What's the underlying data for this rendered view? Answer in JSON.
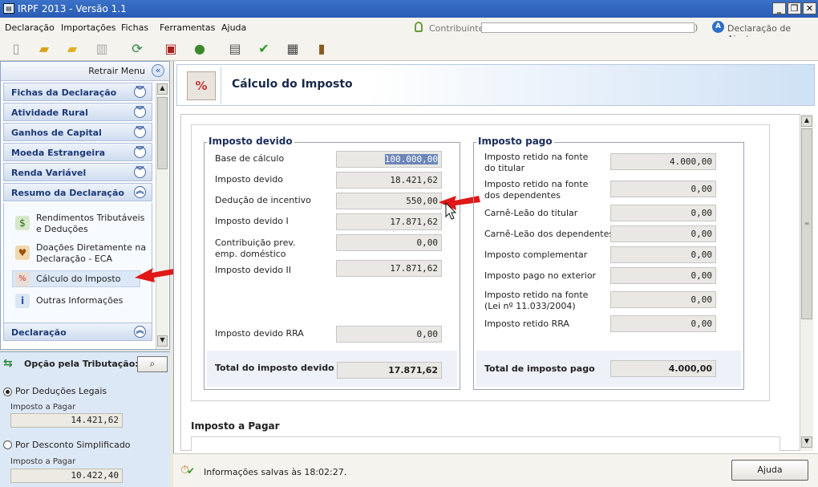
{
  "window": {
    "title": "IRPF 2013 - Versão 1.1",
    "min": "_",
    "max": "❐",
    "close": "✕"
  },
  "menu": [
    {
      "label": "Declaração"
    },
    {
      "label": "Importações"
    },
    {
      "label": "Fichas"
    },
    {
      "label": "Ferramentas"
    },
    {
      "label": "Ajuda"
    }
  ],
  "contribuinte": {
    "label": "Contribuinte:",
    "value": "",
    "end": ")"
  },
  "declaracao_ajuste": "Declaração de Ajuste",
  "toolbar": [
    "new-file-icon",
    "open-folder-icon",
    "folder-icon",
    "trash-icon",
    "transmit-icon",
    "save-icon",
    "globe-icon",
    "printer-icon",
    "check-icon",
    "calculator-icon",
    "book-icon"
  ],
  "sidebar": {
    "retrair": "Retrair Menu",
    "sections": [
      {
        "label": "Fichas da Declaração"
      },
      {
        "label": "Atividade Rural"
      },
      {
        "label": "Ganhos de Capital"
      },
      {
        "label": "Moeda Estrangeira"
      },
      {
        "label": "Renda Variável"
      },
      {
        "label": "Resumo da Declaração"
      }
    ],
    "resumo_items": [
      {
        "label1": "Rendimentos Tributáveis",
        "label2": "e Deduções"
      },
      {
        "label1": "Doações Diretamente na",
        "label2": "Declaração - ECA"
      },
      {
        "label1": "Cálculo do Imposto",
        "label2": ""
      },
      {
        "label1": "Outras Informações",
        "label2": ""
      }
    ],
    "declaracao_section": "Declaração"
  },
  "opcao": {
    "title": "Opção pela Tributação:",
    "deducoes_label": "Por Deduções Legais",
    "deducoes_sub": "Imposto a Pagar",
    "deducoes_value": "14.421,62",
    "simplificado_label": "Por Desconto Simplificado",
    "simplificado_sub": "Imposto a Pagar",
    "simplificado_value": "10.422,40"
  },
  "page_title": "Cálculo do Imposto",
  "imposto_devido": {
    "title": "Imposto devido",
    "rows": [
      {
        "label": "Base de cálculo",
        "value": "100.000,00"
      },
      {
        "label": "Imposto devido",
        "value": "18.421,62"
      },
      {
        "label": "Dedução de incentivo",
        "value": "550,00"
      },
      {
        "label": "Imposto devido I",
        "value": "17.871,62"
      },
      {
        "label": "Contribuição prev.",
        "label2": "emp. doméstico",
        "value": "0,00"
      },
      {
        "label": "Imposto devido II",
        "value": "17.871,62"
      },
      {
        "label": "Imposto devido RRA",
        "value": "0,00"
      }
    ],
    "total_label": "Total do imposto devido",
    "total_value": "17.871,62"
  },
  "imposto_pago": {
    "title": "Imposto pago",
    "rows": [
      {
        "label": "Imposto retido na fonte",
        "label2": "do titular",
        "value": "4.000,00"
      },
      {
        "label": "Imposto retido na fonte",
        "label2": "dos dependentes",
        "value": "0,00"
      },
      {
        "label": "Carnê-Leão do titular",
        "value": "0,00"
      },
      {
        "label": "Carnê-Leão dos dependentes",
        "value": "0,00"
      },
      {
        "label": "Imposto complementar",
        "value": "0,00"
      },
      {
        "label": "Imposto pago no exterior",
        "value": "0,00"
      },
      {
        "label": "Imposto retido na fonte",
        "label2": "(Lei nº 11.033/2004)",
        "value": "0,00"
      },
      {
        "label": "Imposto retido RRA",
        "value": "0,00"
      }
    ],
    "total_label": "Total de imposto pago",
    "total_value": "4.000,00"
  },
  "imposto_a_pagar": "Imposto a Pagar",
  "status": "Informações salvas às 18:02:27.",
  "ajuda_button": "Ajuda"
}
